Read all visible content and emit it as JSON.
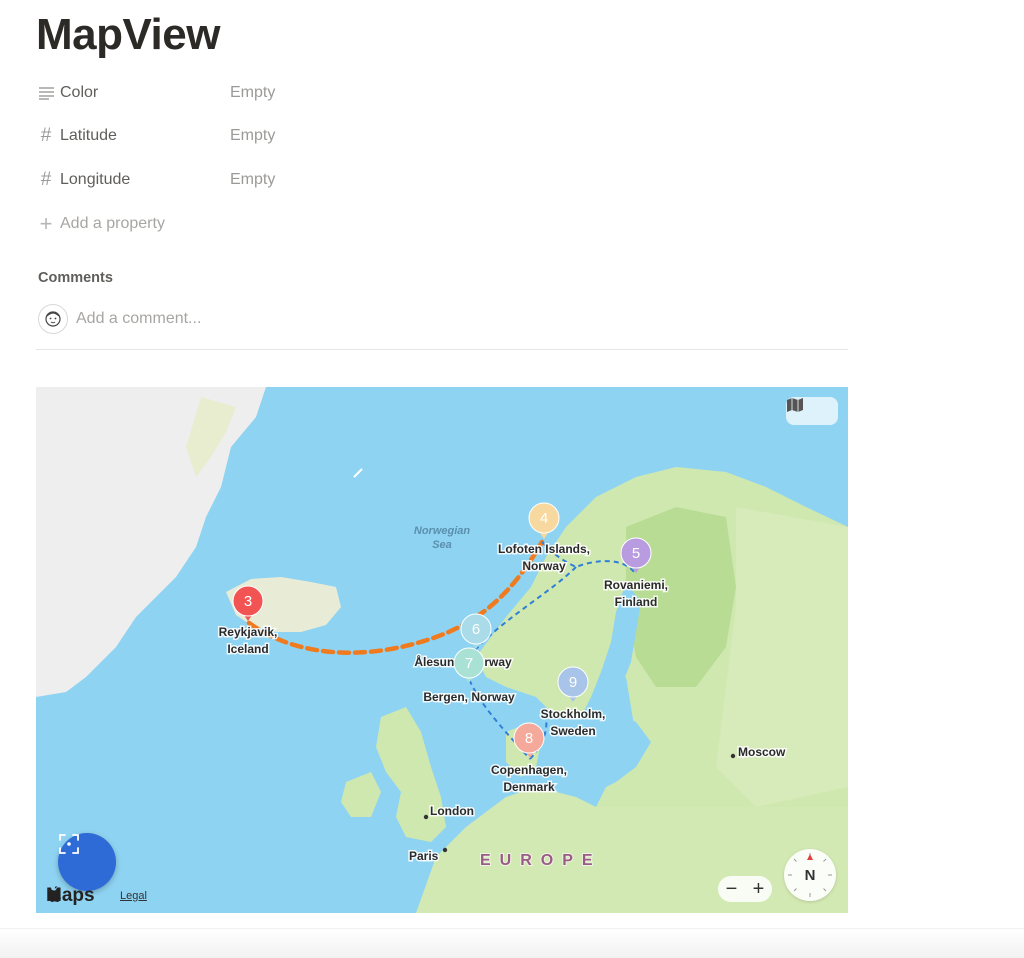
{
  "page": {
    "title": "MapView"
  },
  "properties": [
    {
      "name": "Color",
      "value": "Empty",
      "icon": "text-lines-icon"
    },
    {
      "name": "Latitude",
      "value": "Empty",
      "icon": "number-hash-icon"
    },
    {
      "name": "Longitude",
      "value": "Empty",
      "icon": "number-hash-icon"
    }
  ],
  "add_property_label": "Add a property",
  "comments": {
    "title": "Comments",
    "placeholder": "Add a comment..."
  },
  "map": {
    "sea_label": [
      "Norwegian",
      "Sea"
    ],
    "region_label": "EUROPE",
    "cities": {
      "moscow": "Moscow",
      "london": "London",
      "paris": "Paris"
    },
    "pins": [
      {
        "number": "3",
        "color": "#f25454",
        "label": [
          "Reykjavik,",
          "Iceland"
        ]
      },
      {
        "number": "4",
        "color": "#f7d9a0",
        "label": [
          "Lofoten Islands,",
          "Norway"
        ]
      },
      {
        "number": "5",
        "color": "#b99be0",
        "label": [
          "Rovaniemi,",
          "Finland"
        ]
      },
      {
        "number": "6",
        "color": "#a9dbe8",
        "label": [
          "Ålesund, Norway"
        ]
      },
      {
        "number": "7",
        "color": "#a9e2d4",
        "label": [
          "Bergen, Norway"
        ]
      },
      {
        "number": "8",
        "color": "#f5a99a",
        "label": [
          "Copenhagen,",
          "Denmark"
        ]
      },
      {
        "number": "9",
        "color": "#a8c4e8",
        "label": [
          "Stockholm,",
          "Sweden"
        ]
      }
    ],
    "route_colors": {
      "main": "#f07a1e",
      "secondary": "#2f7fd8"
    },
    "attribution": {
      "brand": "Maps",
      "legal": "Legal"
    },
    "compass_label": "N",
    "zoom": {
      "out": "−",
      "in": "+"
    }
  }
}
